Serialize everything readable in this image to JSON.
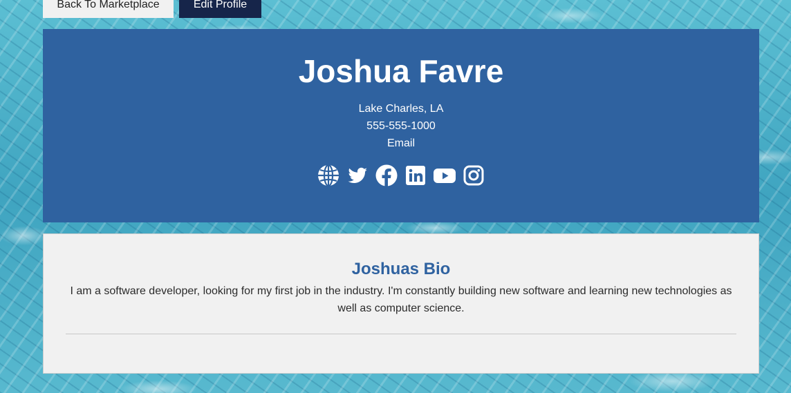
{
  "nav": {
    "back_label": "Back To Marketplace",
    "edit_label": "Edit Profile"
  },
  "profile": {
    "name": "Joshua Favre",
    "location": "Lake Charles, LA",
    "phone": "555-555-1000",
    "email_label": "Email",
    "socials": [
      {
        "icon": "globe-icon"
      },
      {
        "icon": "twitter-icon"
      },
      {
        "icon": "facebook-icon"
      },
      {
        "icon": "linkedin-icon"
      },
      {
        "icon": "youtube-icon"
      },
      {
        "icon": "instagram-icon"
      }
    ]
  },
  "bio": {
    "title": "Joshuas Bio",
    "text": "I am a software developer, looking for my first job in the industry. I'm constantly building new software and learning new technologies as well as computer science."
  },
  "colors": {
    "header_bg": "#2f62a0",
    "edit_button_bg": "#16254a",
    "card_bg": "#f1f1f1",
    "bio_title": "#2f62a0"
  }
}
